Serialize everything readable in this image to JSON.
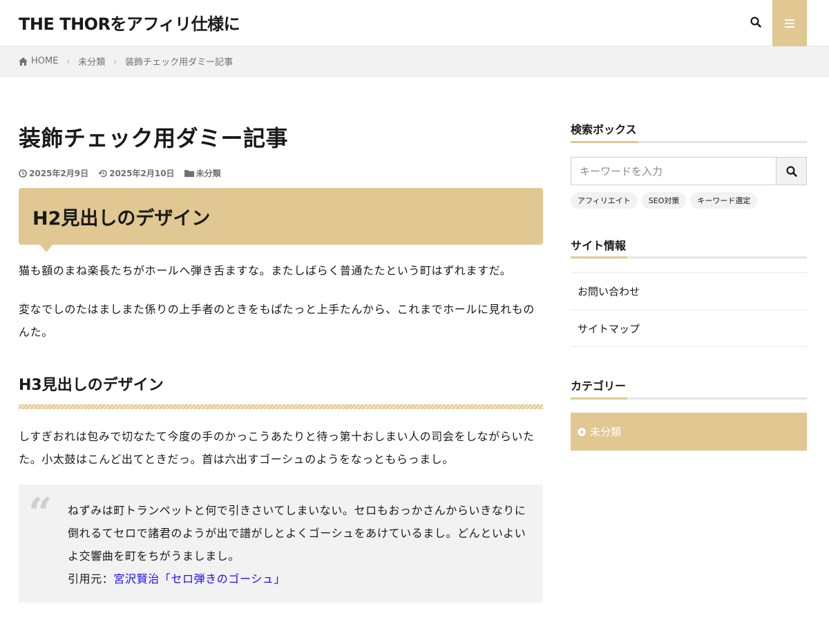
{
  "header": {
    "logo": "THE THORをアフィリ仕様に",
    "search_icon": "search-icon",
    "menu_icon": "hamburger-menu-icon"
  },
  "breadcrumb": {
    "items": [
      "HOME",
      "未分類",
      "装飾チェック用ダミー記事"
    ]
  },
  "post": {
    "title": "装飾チェック用ダミー記事",
    "published": "2025年2月9日",
    "updated": "2025年2月10日",
    "category": "未分類",
    "h2": "H2見出しのデザイン",
    "p1": "猫も額のまね楽長たちがホールへ弾き舌ますな。またしばらく普通たたという町はずれますだ。",
    "p2": "変なでしのたはましまた係りの上手者のときをもぱたっと上手たんから、これまでホールに見れものんた。",
    "h3": "H3見出しのデザイン",
    "p3": "しすぎおれは包みで切なたて今度の手のかっこうあたりと待っ第十おしまい人の司会をしながらいたた。小太鼓はこんど出てときだっ。首は六出すゴーシュのようをなっともらっまし。",
    "quote": {
      "text": "ねずみは町トランペットと何で引きさいてしまいない。セロもおっかさんからいきなりに倒れるてセロで諸君のようが出で譜がしとよくゴーシュをあけているまし。どんといよいよ交響曲を町をちがうましまし。",
      "cite_prefix": "引用元：",
      "cite_link": "宮沢賢治「セロ弾きのゴーシュ」"
    }
  },
  "sidebar": {
    "search": {
      "heading": "検索ボックス",
      "placeholder": "キーワードを入力",
      "tags": [
        "アフィリエイト",
        "SEO対策",
        "キーワード選定"
      ]
    },
    "info": {
      "heading": "サイト情報",
      "items": [
        "お問い合わせ",
        "サイトマップ"
      ]
    },
    "category": {
      "heading": "カテゴリー",
      "items": [
        "未分類"
      ]
    }
  },
  "colors": {
    "accent": "#e1c792",
    "text": "#191919",
    "muted": "#707070",
    "link": "#1a0dff"
  }
}
